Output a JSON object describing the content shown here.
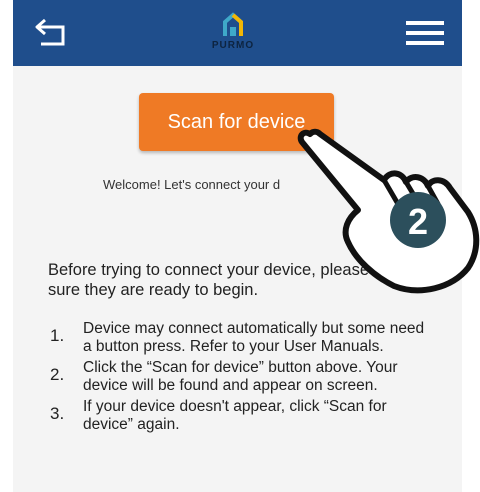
{
  "app": {
    "brand": "PURMO",
    "icons": {
      "back": "back-arrow-icon",
      "menu": "hamburger-menu-icon",
      "logo": "purmo-house-logo-icon",
      "hand": "tap-hand-icon"
    },
    "colors": {
      "header": "#1f4e8c",
      "accent": "#ef7a25",
      "logo_teal": "#3fa9c9",
      "logo_yellow": "#f2b705"
    }
  },
  "main": {
    "scan_button_label": "Scan for device",
    "welcome_text": "Welcome! Let's connect your d",
    "intro_text": "Before trying to connect your device, please make sure they are ready to begin.",
    "steps": [
      {
        "number": "1.",
        "text": "Device may connect automatically but some need a button press. Refer to your User Manuals."
      },
      {
        "number": "2.",
        "text": "Click the “Scan for device” button above. Your device will be found and appear on screen."
      },
      {
        "number": "3.",
        "text": "If your device doesn't appear, click “Scan for device” again."
      }
    ]
  },
  "annotation": {
    "step_badge": "2"
  }
}
